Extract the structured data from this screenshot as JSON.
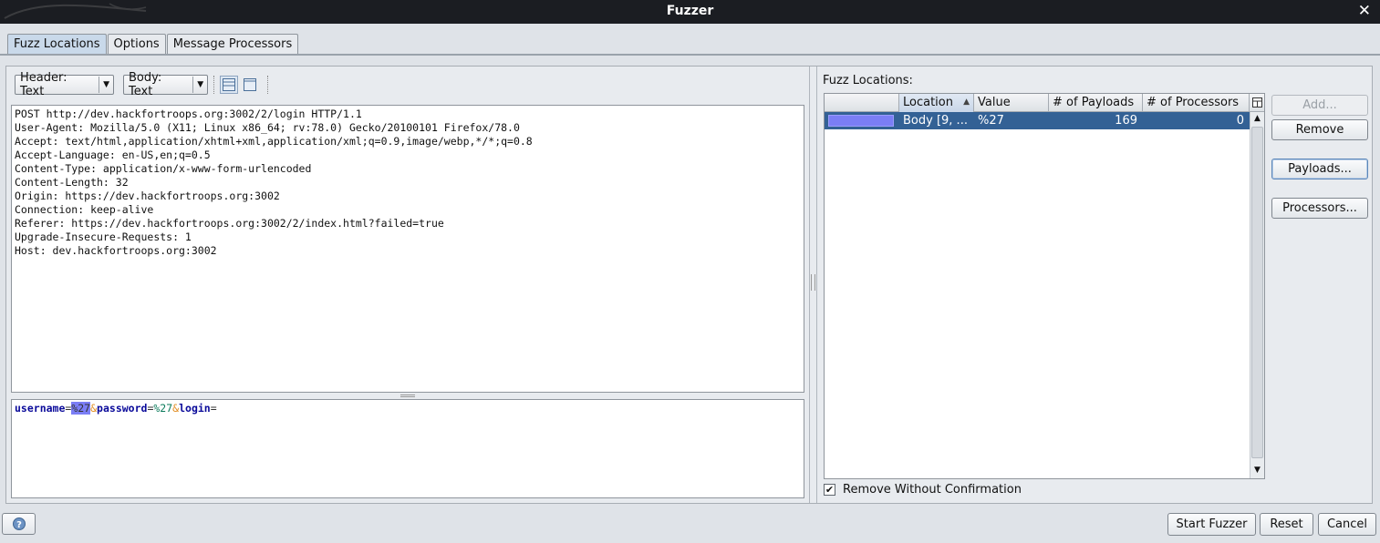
{
  "window": {
    "title": "Fuzzer",
    "close_glyph": "✕"
  },
  "tabs": [
    {
      "label": "Fuzz Locations",
      "active": true
    },
    {
      "label": "Options",
      "active": false
    },
    {
      "label": "Message Processors",
      "active": false
    }
  ],
  "request_panel": {
    "header_view": "Header: Text",
    "body_view": "Body: Text",
    "header_text": "POST http://dev.hackfortroops.org:3002/2/login HTTP/1.1\nUser-Agent: Mozilla/5.0 (X11; Linux x86_64; rv:78.0) Gecko/20100101 Firefox/78.0\nAccept: text/html,application/xhtml+xml,application/xml;q=0.9,image/webp,*/*;q=0.8\nAccept-Language: en-US,en;q=0.5\nContent-Type: application/x-www-form-urlencoded\nContent-Length: 32\nOrigin: https://dev.hackfortroops.org:3002\nConnection: keep-alive\nReferer: https://dev.hackfortroops.org:3002/2/index.html?failed=true\nUpgrade-Insecure-Requests: 1\nHost: dev.hackfortroops.org:3002",
    "body_tokens": {
      "k1": "username",
      "eq1": "=",
      "v1": "%27",
      "amp1": "&",
      "k2": "password",
      "eq2": "=",
      "v2": "%27",
      "amp2": "&",
      "k3": "login",
      "eq3": "="
    },
    "highlight_color": "#7b7ef5"
  },
  "fuzz_locations": {
    "label": "Fuzz Locations:",
    "columns": [
      "",
      "Location",
      "Value",
      "# of Payloads",
      "# of Processors"
    ],
    "sorted_column": "Location",
    "sort_direction": "ascending",
    "rows": [
      {
        "color": "#7b7ef5",
        "location": "Body [9, ...",
        "value": "%27",
        "payloads": "169",
        "processors": "0",
        "selected": true
      }
    ],
    "buttons": {
      "add": "Add...",
      "remove": "Remove",
      "payloads": "Payloads...",
      "processors": "Processors..."
    },
    "remove_without_confirmation": {
      "label": "Remove Without Confirmation",
      "checked": true
    }
  },
  "footer": {
    "help_icon": "help-icon",
    "start": "Start Fuzzer",
    "reset": "Reset",
    "cancel": "Cancel"
  },
  "colors": {
    "titlebar": "#1b1d22",
    "selection": "#336195",
    "tab_active": "#c9d9ea"
  }
}
